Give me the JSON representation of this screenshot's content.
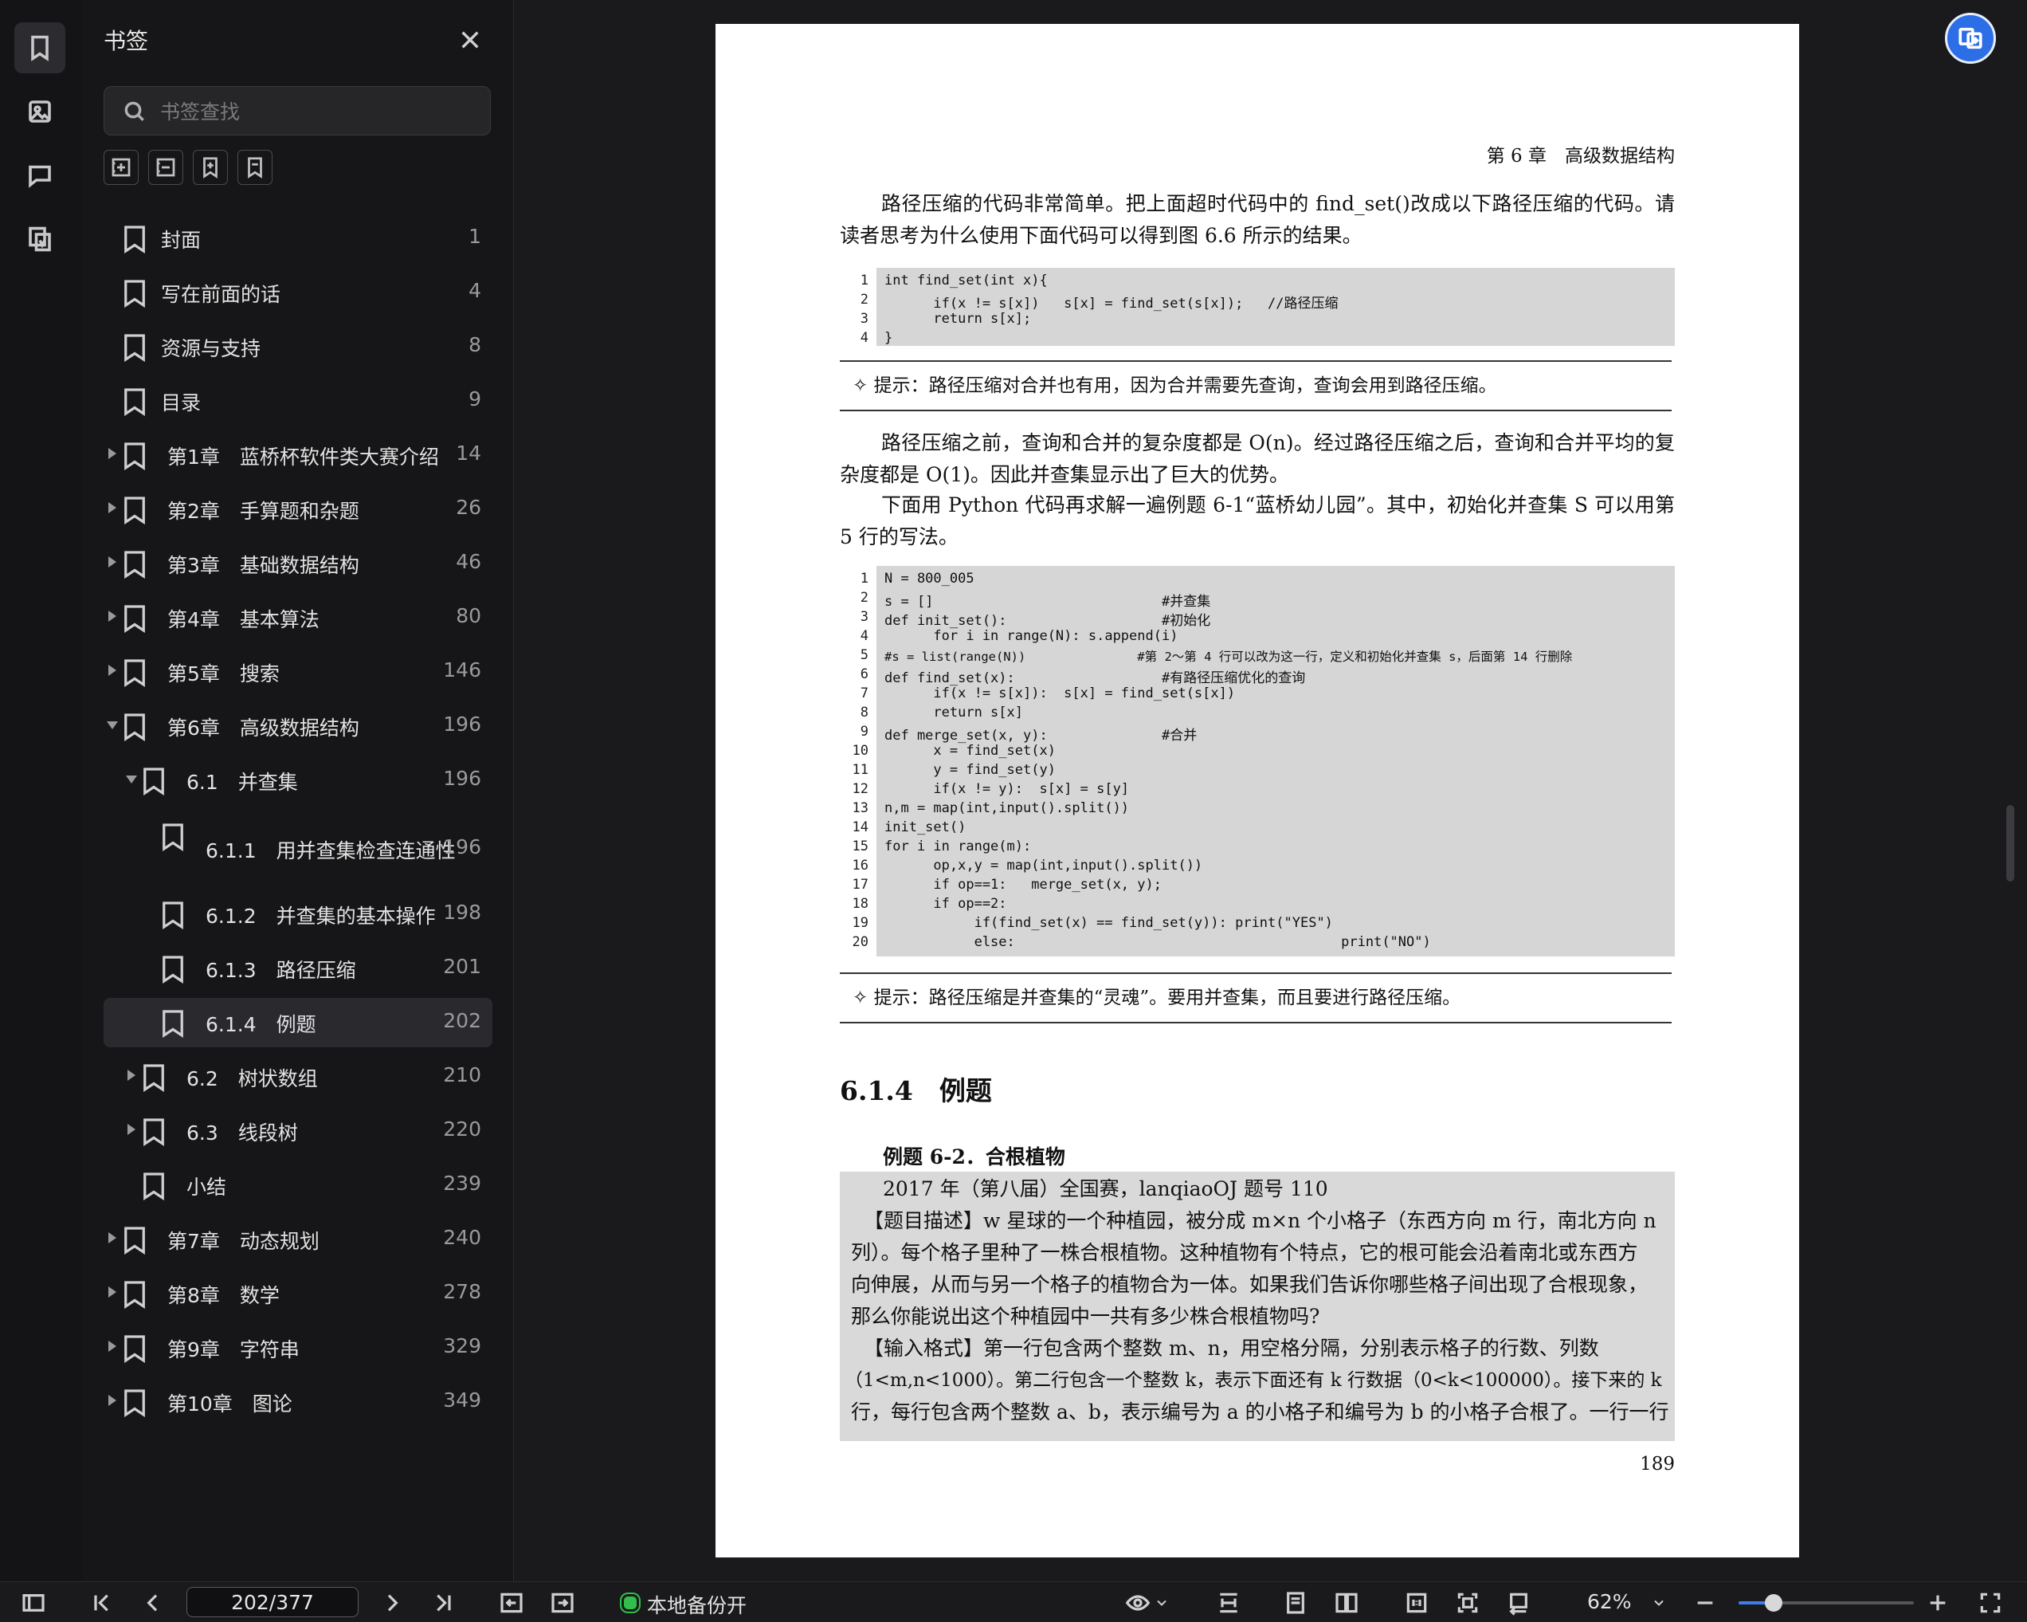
{
  "sidebar": {
    "title": "书签",
    "search_placeholder": "书签查找",
    "bookmarks": [
      {
        "label": "封面",
        "page": "1"
      },
      {
        "label": "写在前面的话",
        "page": "4"
      },
      {
        "label": "资源与支持",
        "page": "8"
      },
      {
        "label": "目录",
        "page": "9"
      },
      {
        "label": "第1章　蓝桥杯软件类大赛介绍",
        "page": "14"
      },
      {
        "label": "第2章　手算题和杂题",
        "page": "26"
      },
      {
        "label": "第3章　基础数据结构",
        "page": "46"
      },
      {
        "label": "第4章　基本算法",
        "page": "80"
      },
      {
        "label": "第5章　搜索",
        "page": "146"
      },
      {
        "label": "第6章　高级数据结构",
        "page": "196"
      },
      {
        "label": "6.1　并查集",
        "page": "196"
      },
      {
        "label": "6.1.1　用并查集检查连通性",
        "page": "196"
      },
      {
        "label": "6.1.2　并查集的基本操作",
        "page": "198"
      },
      {
        "label": "6.1.3　路径压缩",
        "page": "201"
      },
      {
        "label": "6.1.4　例题",
        "page": "202"
      },
      {
        "label": "6.2　树状数组",
        "page": "210"
      },
      {
        "label": "6.3　线段树",
        "page": "220"
      },
      {
        "label": "小结",
        "page": "239"
      },
      {
        "label": "第7章　动态规划",
        "page": "240"
      },
      {
        "label": "第8章　数学",
        "page": "278"
      },
      {
        "label": "第9章　字符串",
        "page": "329"
      },
      {
        "label": "第10章　图论",
        "page": "349"
      }
    ]
  },
  "document": {
    "header": "第 6 章　高级数据结构",
    "para1": "路径压缩的代码非常简单。把上面超时代码中的 find_set()改成以下路径压缩的代码。请读者思考为什么使用下面代码可以得到图 6.6 所示的结果。",
    "code1": [
      "int find_set(int x){",
      "      if(x != s[x])   s[x] = find_set(s[x]);   //路径压缩",
      "      return s[x];",
      "}"
    ],
    "tip1": "✧ 提示：路径压缩对合并也有用，因为合并需要先查询，查询会用到路径压缩。",
    "para2": "路径压缩之前，查询和合并的复杂度都是 O(n)。经过路径压缩之后，查询和合并平均的复杂度都是 O(1)。因此并查集显示出了巨大的优势。",
    "para3": "下面用 Python 代码再求解一遍例题 6-1“蓝桥幼儿园”。其中，初始化并查集 S 可以用第 5 行的写法。",
    "code2": [
      "N = 800_005",
      "s = []                            #并查集",
      "def init_set():                   #初始化",
      "      for i in range(N): s.append(i)",
      "#s = list(range(N))               #第 2～第 4 行可以改为这一行，定义和初始化并查集 s，后面第 14 行删除",
      "def find_set(x):                  #有路径压缩优化的查询",
      "      if(x != s[x]):  s[x] = find_set(s[x])",
      "      return s[x]",
      "def merge_set(x, y):              #合并",
      "      x = find_set(x)",
      "      y = find_set(y)",
      "      if(x != y):  s[x] = s[y]",
      "n,m = map(int,input().split())",
      "init_set()",
      "for i in range(m):",
      "      op,x,y = map(int,input().split())",
      "      if op==1:   merge_set(x, y);",
      "      if op==2:",
      "           if(find_set(x) == find_set(y)): print(\"YES\")",
      "           else:                                        print(\"NO\")"
    ],
    "tip2": "✧ 提示：路径压缩是并查集的“灵魂”。要用并查集，而且要进行路径压缩。",
    "section_title": "6.1.4　例题",
    "example_title": "例题 6-2．合根植物",
    "example_lines": [
      "2017 年（第八届）全国赛，lanqiaoOJ 题号 110",
      "【题目描述】w 星球的一个种植园，被分成 m×n 个小格子（东西方向 m 行，南北方向 n",
      "列）。每个格子里种了一株合根植物。这种植物有个特点，它的根可能会沿着南北或东西方",
      "向伸展，从而与另一个格子的植物合为一体。如果我们告诉你哪些格子间出现了合根现象，",
      "那么你能说出这个种植园中一共有多少株合根植物吗?",
      "【输入格式】第一行包含两个整数 m、n，用空格分隔，分别表示格子的行数、列数",
      "（1<m,n<1000）。第二行包含一个整数 k，表示下面还有 k 行数据（0<k<100000）。接下来的 k",
      "行，每行包含两个整数 a、b，表示编号为 a 的小格子和编号为 b 的小格子合根了。一行一行"
    ],
    "page_number": "189"
  },
  "statusbar": {
    "current_page": "202/377",
    "backup_label": "本地备份开",
    "zoom": "62%",
    "zoom_fraction": 0.2
  }
}
